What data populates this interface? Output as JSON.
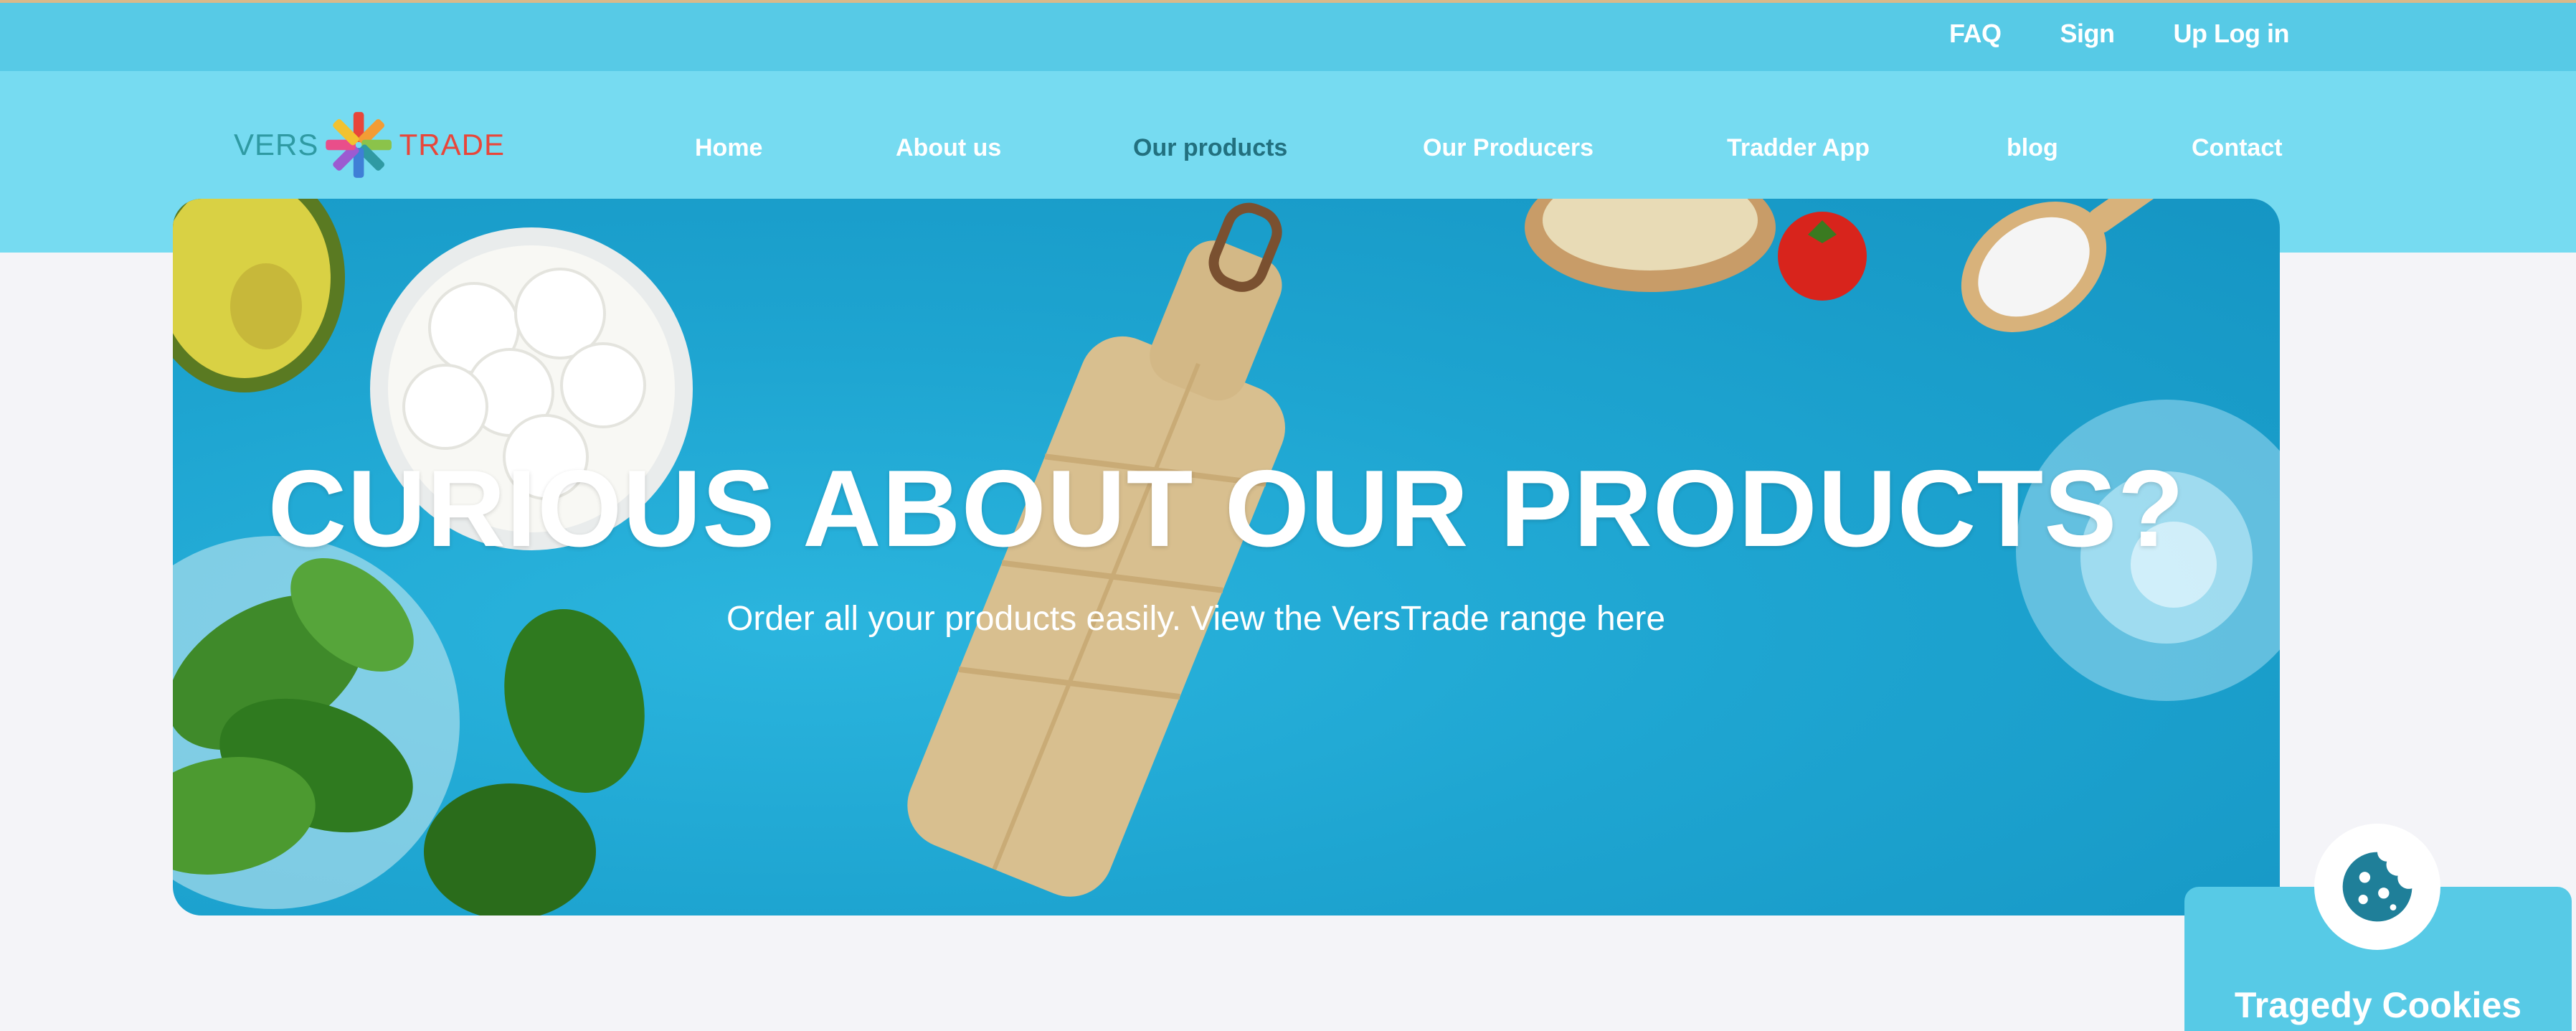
{
  "topbar": {
    "links": [
      "FAQ",
      "Sign",
      "Up Log in"
    ]
  },
  "logo": {
    "left_text": "VERS",
    "right_text": "TRADE"
  },
  "nav": {
    "items": [
      "Home",
      "About us",
      "Our products",
      "Our Producers",
      "Tradder App",
      "blog",
      "Contact"
    ],
    "active": "Our products"
  },
  "hero": {
    "title": "CURIOUS ABOUT OUR PRODUCTS?",
    "subtitle": "Order all your products easily. View the VersTrade range here"
  },
  "cookie_widget": {
    "title": "Tragedy Cookies",
    "icon": "cookie-icon"
  },
  "colors": {
    "topbar": "#57cae6",
    "navband": "#76dbf1",
    "active_nav": "#22707f",
    "hero_bg": "#1ea5d1",
    "page_bg": "#f4f4f8"
  }
}
